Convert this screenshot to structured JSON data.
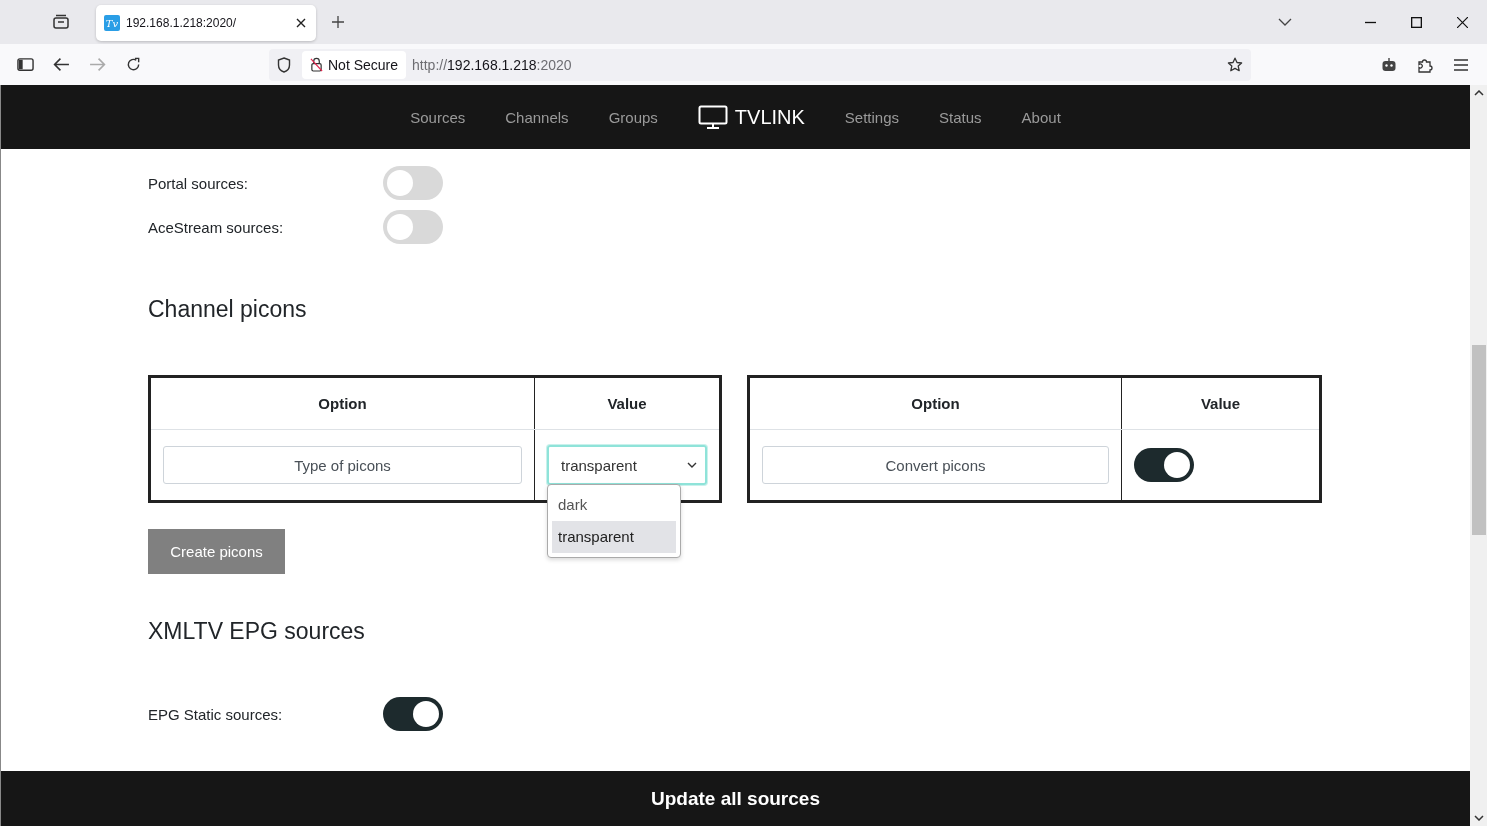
{
  "browser": {
    "tabs": [
      {
        "title": "192.168.1.218:2020/",
        "favicon": "Tv",
        "selected": true
      }
    ],
    "address": {
      "security": "Not Secure",
      "scheme": "http://",
      "host": "192.168.1.218",
      "port": ":2020"
    }
  },
  "nav": [
    {
      "label": "Sources",
      "kind": "link"
    },
    {
      "label": "Channels",
      "kind": "link"
    },
    {
      "label": "Groups",
      "kind": "link"
    },
    {
      "label": "TVLINK",
      "kind": "brand"
    },
    {
      "label": "Settings",
      "kind": "link"
    },
    {
      "label": "Status",
      "kind": "link"
    },
    {
      "label": "About",
      "kind": "link"
    }
  ],
  "source_toggles": [
    {
      "label": "Portal sources:",
      "on": false
    },
    {
      "label": "AceStream sources:",
      "on": false
    }
  ],
  "picons": {
    "heading": "Channel picons",
    "tables": [
      {
        "columns": [
          "Option",
          "Value"
        ],
        "rows": [
          {
            "option": "Type of picons",
            "kind": "select",
            "value": "transparent",
            "open": true,
            "options": [
              {
                "label": "dark",
                "selected": false
              },
              {
                "label": "transparent",
                "selected": true
              }
            ]
          }
        ]
      },
      {
        "columns": [
          "Option",
          "Value"
        ],
        "rows": [
          {
            "option": "Convert picons",
            "kind": "toggle",
            "on": true
          }
        ]
      }
    ],
    "button": "Create picons"
  },
  "epg": {
    "heading": "XMLTV EPG sources",
    "toggles": [
      {
        "label": "EPG Static sources:",
        "on": true
      }
    ]
  },
  "footer_button": "Update all sources"
}
